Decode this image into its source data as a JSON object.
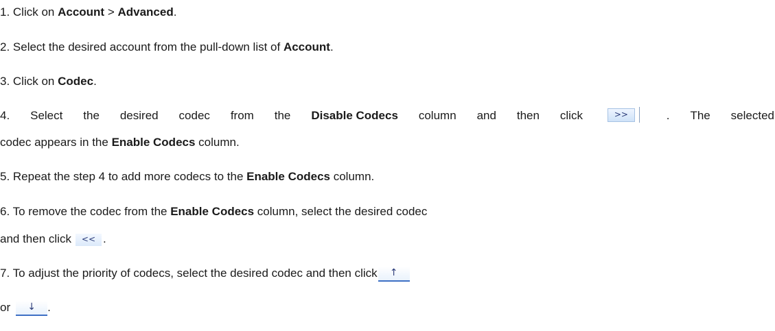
{
  "steps": {
    "s1": {
      "pre": "1. Click on ",
      "b1": "Account",
      "mid": " > ",
      "b2": "Advanced",
      "post": "."
    },
    "s2": {
      "pre": "2. Select the desired account from the pull-down list of ",
      "b1": "Account",
      "post": "."
    },
    "s3": {
      "pre": "3. Click on ",
      "b1": "Codec",
      "post": "."
    },
    "s4": {
      "w1": "4.",
      "w2": "Select",
      "w3": "the",
      "w4": "desired",
      "w5": "codec",
      "w6": "from",
      "w7": "the",
      "b1": "Disable Codecs",
      "w8": "column",
      "w9": "and",
      "w10": "then",
      "w11": "click",
      "w12": ".",
      "w13": "The",
      "w14": "selected",
      "line2_pre": "codec appears in the ",
      "b2": "Enable Codecs",
      "line2_post": " column."
    },
    "s5": {
      "pre": "5. Repeat the step 4 to add more codecs to the ",
      "b1": "Enable Codecs",
      "post": " column."
    },
    "s6": {
      "pre": "6. To remove the codec from the ",
      "b1": "Enable Codecs",
      "post": " column, select the desired codec",
      "line2_pre": "and then click",
      "line2_post": "."
    },
    "s7": {
      "text": "7. To adjust the priority of codecs, select the desired codec and then click",
      "line2_pre": "or",
      "line2_post": "."
    }
  },
  "buttons": {
    "forward": ">>",
    "back": "<<",
    "up": "↑",
    "down": "↓"
  }
}
